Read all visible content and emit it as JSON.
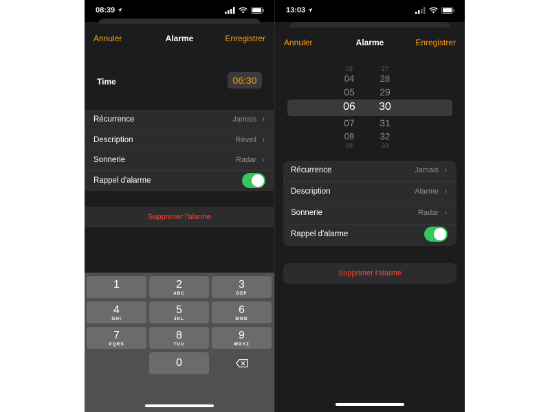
{
  "left": {
    "status_time": "08:39",
    "nav": {
      "cancel": "Annuler",
      "title": "Alarme",
      "save": "Enregistrer"
    },
    "time_label": "Time",
    "time_value": "06:30",
    "rows": [
      {
        "label": "Récurrence",
        "value": "Jamais"
      },
      {
        "label": "Description",
        "value": "Réveil"
      },
      {
        "label": "Sonnerie",
        "value": "Radar"
      },
      {
        "label": "Rappel d'alarme",
        "toggle": true
      }
    ],
    "delete_label": "Supprimer l'alarme",
    "keypad": [
      {
        "num": "1",
        "letters": ""
      },
      {
        "num": "2",
        "letters": "ABC"
      },
      {
        "num": "3",
        "letters": "DEF"
      },
      {
        "num": "4",
        "letters": "GHI"
      },
      {
        "num": "5",
        "letters": "JKL"
      },
      {
        "num": "6",
        "letters": "MNO"
      },
      {
        "num": "7",
        "letters": "PQRS"
      },
      {
        "num": "8",
        "letters": "TUV"
      },
      {
        "num": "9",
        "letters": "WXYZ"
      },
      {
        "num": "0",
        "letters": ""
      }
    ]
  },
  "right": {
    "status_time": "13:03",
    "nav": {
      "cancel": "Annuler",
      "title": "Alarme",
      "save": "Enregistrer"
    },
    "picker": {
      "hours": [
        "03",
        "04",
        "05",
        "06",
        "07",
        "08",
        "09"
      ],
      "minutes": [
        "27",
        "28",
        "29",
        "30",
        "31",
        "32",
        "33"
      ],
      "selected_hour": "06",
      "selected_minute": "30"
    },
    "rows": [
      {
        "label": "Récurrence",
        "value": "Jamais"
      },
      {
        "label": "Description",
        "value": "Alarme"
      },
      {
        "label": "Sonnerie",
        "value": "Radar"
      },
      {
        "label": "Rappel d'alarme",
        "toggle": true
      }
    ],
    "delete_label": "Supprimer l'alarme"
  },
  "colors": {
    "accent": "#ff9f0a",
    "destructive": "#ff453a",
    "toggle_on": "#34c759",
    "background": "#1c1c1e",
    "cell": "#2c2c2e"
  },
  "icons": [
    "location-arrow-icon",
    "signal-icon",
    "wifi-icon",
    "battery-icon",
    "chevron-right-icon",
    "backspace-icon"
  ]
}
